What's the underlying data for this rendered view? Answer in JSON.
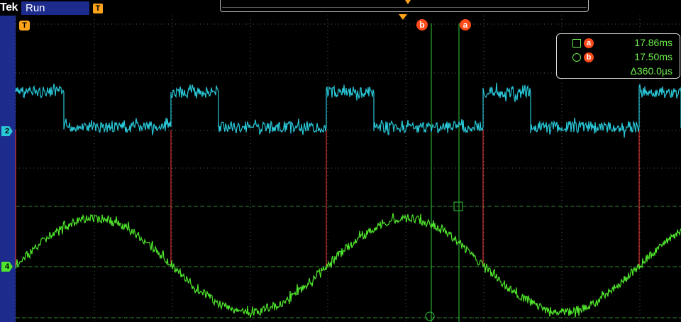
{
  "header": {
    "brand": "Tek",
    "status": "Run",
    "trigger_symbol": "T"
  },
  "cursors": {
    "a_label": "a",
    "b_label": "b",
    "a_time": "17.86ms",
    "b_time": "17.50ms",
    "delta": "Δ360.0µs"
  },
  "channels": [
    {
      "id": "2",
      "name": "channel-2",
      "color": "#29c8d8"
    },
    {
      "id": "4",
      "name": "channel-4",
      "color": "#4fe62c"
    }
  ],
  "trigger": {
    "marker": "T",
    "color": "#ffa31a"
  },
  "colors": {
    "ch2": "#29c8d8",
    "ch4": "#4fe62c",
    "cursor": "#32c93a",
    "trigger": "#ffa31a",
    "edge_marks": "#ff3b3b",
    "readout_text": "#6ef04e",
    "badge": "#ff4a1a"
  }
}
